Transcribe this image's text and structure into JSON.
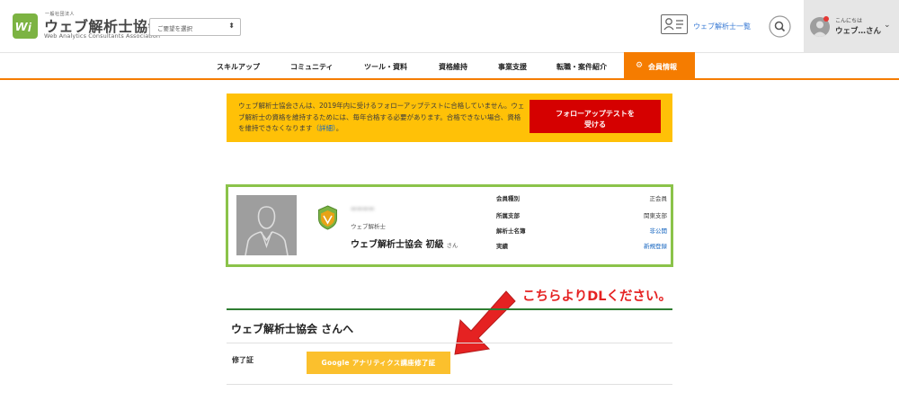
{
  "header": {
    "logo_sup": "一般社団法人",
    "logo_jp": "ウェブ解析士協会",
    "logo_en": "Web Analytics Consultants Association",
    "pref_select": "ご要望を選択",
    "list_link": "ウェブ解析士一覧",
    "greeting": "こんにちは",
    "username": "ウェブ…さん"
  },
  "nav": {
    "items": [
      "スキルアップ",
      "コミュニティ",
      "ツール・資料",
      "資格維持",
      "事業支援",
      "転職・案件紹介"
    ],
    "member_label": "会員情報"
  },
  "notice": {
    "text": "ウェブ解析士協会さんは、2019年内に受けるフォローアップテストに合格していません。ウェブ解析士の資格を維持するためには、毎年合格する必要があります。合格できない場合、資格を維持できなくなります",
    "link": "（詳細）",
    "tail": "。",
    "button_line1": "フォローアップテストを",
    "button_line2": "受ける"
  },
  "profile": {
    "role": "ウェブ解析士",
    "name": "ウェブ解析士協会 初級",
    "suffix": "さん",
    "info": [
      {
        "key": "会員種別",
        "value": "正会員"
      },
      {
        "key": "所属支部",
        "value": "関東支部"
      },
      {
        "key": "解析士名簿",
        "value": "非公開"
      },
      {
        "key": "実績",
        "value": "新規登録"
      }
    ]
  },
  "annotation": "こちらよりDLください。",
  "section": {
    "title": "ウェブ解析士協会 さんへ",
    "cert_label": "修了証",
    "cert_button": "Google アナリティクス講座修了証"
  },
  "colors": {
    "accent": "#f57c00",
    "notice_bg": "#ffc107",
    "notice_button": "#d50000",
    "card_border": "#8bc34a",
    "section_line": "#2e7d32",
    "cert_button": "#fbc02d",
    "annotation": "#e52222"
  }
}
